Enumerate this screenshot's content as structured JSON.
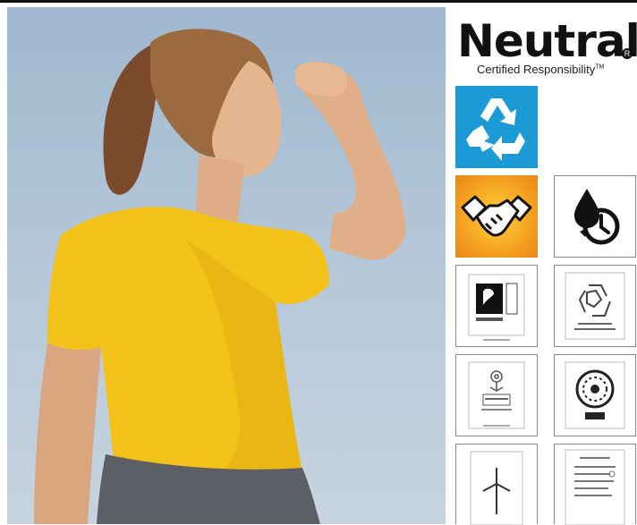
{
  "brand": {
    "name": "Neutral",
    "mark": "R",
    "tagline": "Certified Responsibility",
    "tagline_tm": "TM"
  },
  "photo": {
    "subject": "woman-in-yellow-tshirt-shading-eyes"
  },
  "tiles": [
    {
      "icon": "recycle-icon",
      "color": "#1c9ad6"
    },
    {
      "icon": "handshake-icon",
      "color": "#f39a1e"
    },
    {
      "icon": "water-drop-clock-icon",
      "color": "#111111"
    },
    {
      "icon": "fairtrade-certificate-icon"
    },
    {
      "icon": "recycled-certificate-icon"
    },
    {
      "icon": "ecolabel-certificate-icon"
    },
    {
      "icon": "seal-certificate-icon"
    },
    {
      "icon": "wind-turbine-certificate-icon"
    },
    {
      "icon": "text-certificate-icon"
    }
  ],
  "colors": {
    "accent_blue": "#1c9ad6",
    "accent_orange": "#f39a1e",
    "shirt_yellow": "#f2c21b"
  }
}
